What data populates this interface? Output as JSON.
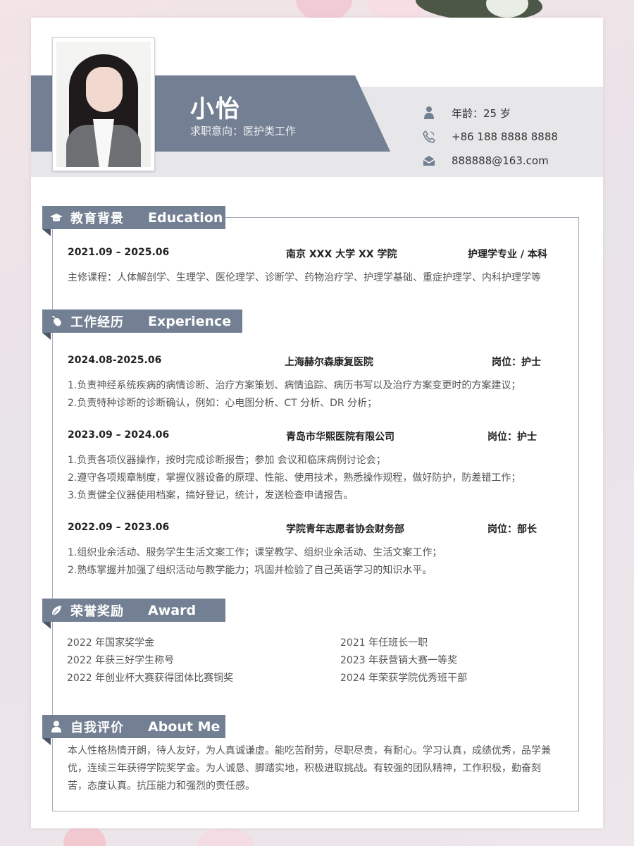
{
  "profile": {
    "name": "小怡",
    "job_intent": "求职意向：医护类工作",
    "age": "年龄：25 岁",
    "phone": "+86 188 8888 8888",
    "email": "888888@163.com"
  },
  "sections": {
    "education": {
      "cn": "教育背景",
      "en": "Education"
    },
    "experience": {
      "cn": "工作经历",
      "en": "Experience"
    },
    "award": {
      "cn": "荣誉奖励",
      "en": "Award"
    },
    "about": {
      "cn": "自我评价",
      "en": "About Me"
    }
  },
  "education": {
    "period": "2021.09 – 2025.06",
    "school": "南京 XXX 大学 XX 学院",
    "major": "护理学专业 / 本科",
    "courses": "主修课程：人体解剖学、生理学、医伦理学、诊断学、药物治疗学、护理学基础、重症护理学、内科护理学等"
  },
  "experience": [
    {
      "period": "2024.08-2025.06",
      "org": "上海赫尔森康复医院",
      "role": "岗位：护士",
      "lines": [
        "1.负责神经系统疾病的病情诊断、治疗方案策划、病情追踪、病历书写以及治疗方案变更时的方案建议；",
        "2.负责特种诊断的诊断确认，例如：心电图分析、CT 分析、DR 分析；"
      ]
    },
    {
      "period": "2023.09 – 2024.06",
      "org": "青岛市华熙医院有限公司",
      "role": "岗位：护士",
      "lines": [
        "1.负责各项仪器操作，按时完成诊断报告；参加 会议和临床病例讨论会；",
        "2.遵守各项规章制度，掌握仪器设备的原理、性能、使用技术，熟悉操作规程，做好防护，防差错工作；",
        "3.负责健全仪器使用档案，搞好登记，统计，发送检查申请报告。"
      ]
    },
    {
      "period": "2022.09 – 2023.06",
      "org": "学院青年志愿者协会财务部",
      "role": "岗位：部长",
      "lines": [
        "1.组织业余活动、服务学生生活文案工作；课堂教学、组织业余活动、生活文案工作；",
        "2.熟练掌握并加强了组织活动与教学能力；巩固并检验了自己英语学习的知识水平。"
      ]
    }
  ],
  "awards": {
    "left": [
      "2022 年国家奖学金",
      "2022 年获三好学生称号",
      "2022 年创业杯大赛获得团体比赛铜奖"
    ],
    "right": [
      "2021 年任班长一职",
      "2023 年获营销大赛一等奖",
      "2024 年荣获学院优秀班干部"
    ]
  },
  "about": "本人性格热情开朗，待人友好，为人真诚谦虚。能吃苦耐劳，尽职尽责，有耐心。学习认真，成绩优秀，品学兼优，连续三年获得学院奖学金。为人诚恳、脚踏实地，积极进取挑战。有较强的团队精神，工作积极，勤奋刻苦，态度认真。抗压能力和强烈的责任感。",
  "colors": {
    "accent": "#737f92",
    "band": "#e7e7e9",
    "frame": "#a7adb8"
  },
  "icons": [
    "person-icon",
    "phone-icon",
    "mail-icon",
    "graduation-cap-icon",
    "mouse-icon",
    "leaf-icon",
    "user-icon"
  ]
}
